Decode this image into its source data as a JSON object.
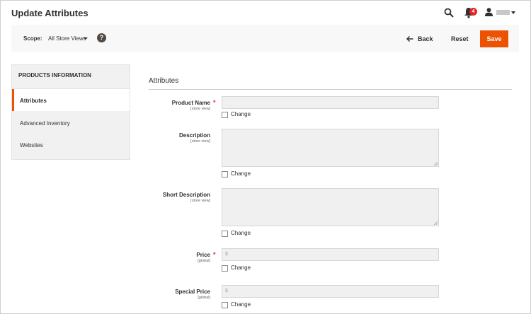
{
  "header": {
    "title": "Update Attributes",
    "notifications_count": "4",
    "icons": {
      "search": "search-icon",
      "notifications": "bell-icon",
      "user": "user-icon",
      "user_menu": "caret-down-icon"
    }
  },
  "toolbar": {
    "scope_label": "Scope:",
    "scope_value": "All Store Views",
    "help_icon_glyph": "?",
    "back_label": "Back",
    "reset_label": "Reset",
    "save_label": "Save",
    "accent_color": "#eb5202"
  },
  "sidebar": {
    "title": "PRODUCTS INFORMATION",
    "items": [
      {
        "label": "Attributes",
        "active": true
      },
      {
        "label": "Advanced Inventory",
        "active": false
      },
      {
        "label": "Websites",
        "active": false
      }
    ]
  },
  "main": {
    "section_title": "Attributes",
    "change_label": "Change",
    "fields": [
      {
        "label": "Product Name",
        "scope": "[store view]",
        "required": true,
        "type": "text",
        "value": ""
      },
      {
        "label": "Description",
        "scope": "[store view]",
        "required": false,
        "type": "textarea",
        "value": ""
      },
      {
        "label": "Short Description",
        "scope": "[store view]",
        "required": false,
        "type": "textarea",
        "value": ""
      },
      {
        "label": "Price",
        "scope": "[global]",
        "required": true,
        "type": "price",
        "currency_symbol": "$",
        "value": ""
      },
      {
        "label": "Special Price",
        "scope": "[global]",
        "required": false,
        "type": "price",
        "currency_symbol": "$",
        "value": ""
      }
    ],
    "required_mark": "*"
  }
}
